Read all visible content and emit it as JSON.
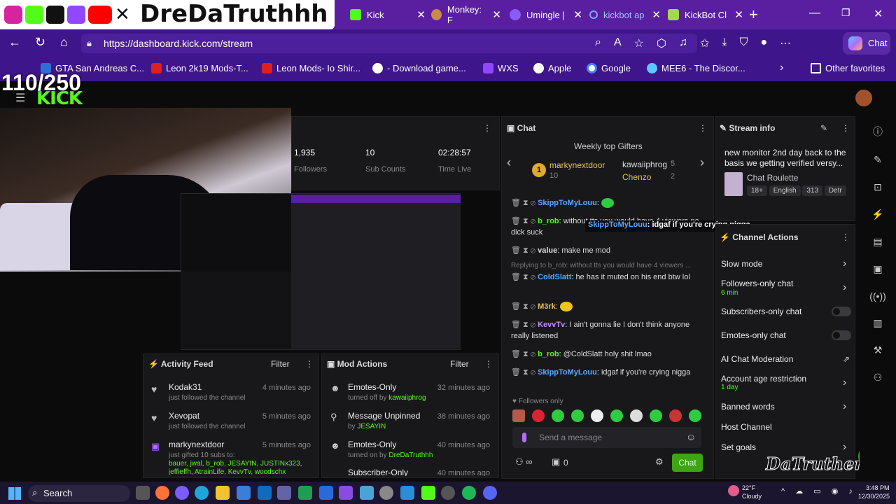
{
  "overlay": {
    "brand_name": "DreDaTruthhh",
    "counter": "110/250",
    "watermark": "DaTruthers"
  },
  "tabs": [
    {
      "label": "Kick"
    },
    {
      "label": "Monkey: F"
    },
    {
      "label": "Umingle |"
    },
    {
      "label": "kickbot ap"
    },
    {
      "label": "KickBot Cl"
    }
  ],
  "browser": {
    "url": "https://dashboard.kick.com/stream",
    "chat_label": "Chat"
  },
  "bookmarks": [
    {
      "label": "GTA San Andreas C..."
    },
    {
      "label": "Leon 2k19 Mods-T..."
    },
    {
      "label": "Leon Mods- Io Shir..."
    },
    {
      "label": "- Download game..."
    },
    {
      "label": "WXS"
    },
    {
      "label": "Apple"
    },
    {
      "label": "Google"
    },
    {
      "label": "MEE6 - The Discor..."
    },
    {
      "label": "Other favorites"
    }
  ],
  "kick": {
    "logo": "KICK",
    "stats": {
      "followers": "1,935",
      "followers_label": "Followers",
      "subs": "10",
      "subs_label": "Sub Counts",
      "time": "02:28:57",
      "time_label": "Time Live"
    }
  },
  "activity": {
    "title": "Activity Feed",
    "filter": "Filter",
    "items": [
      {
        "name": "Kodak31",
        "text": "just followed the channel",
        "time": "4 minutes ago"
      },
      {
        "name": "Xevopat",
        "text": "just followed the channel",
        "time": "5 minutes ago"
      },
      {
        "name": "markynextdoor",
        "text": "just gifted 10 subs to:",
        "time": "5 minutes ago",
        "extra": "bauer, jwal, b_rob, JESAYIN, JUSTINx323,",
        "extra2": "jeffieffh, AtrainLife, KevvTv, woodschx"
      }
    ]
  },
  "mod": {
    "title": "Mod Actions",
    "filter": "Filter",
    "items": [
      {
        "name": "Emotes-Only",
        "text": "turned off by",
        "by": "kawaiiphrog",
        "time": "32 minutes ago"
      },
      {
        "name": "Message Unpinned",
        "text": "by",
        "by": "JESAYIN",
        "time": "38 minutes ago"
      },
      {
        "name": "Emotes-Only",
        "text": "turned on by",
        "by": "DreDaTruthhh",
        "time": "40 minutes ago"
      },
      {
        "name": "Subscriber-Only",
        "text": "",
        "by": "",
        "time": "40 minutes ago"
      }
    ]
  },
  "chat": {
    "title": "Chat",
    "gifters_title": "Weekly top Gifters",
    "gifters": [
      {
        "name": "markynextdoor",
        "count": "10"
      },
      {
        "name": "kawaiiphrog",
        "count": "5"
      },
      {
        "name": "Chenzo",
        "count": "2"
      }
    ],
    "messages": [
      {
        "user": "SkippToMyLouu",
        "text": ""
      },
      {
        "user": "b_rob",
        "text": "without tts you would have 4 viewers no dick suck"
      },
      {
        "user": "value",
        "text": "make me mod"
      },
      {
        "reply": "Replying to b_rob: without tts you would have 4 viewers ...",
        "user": "ColdSlatt",
        "text": "he has it muted on his end btw lol"
      },
      {
        "user": "M3rk",
        "text": ""
      },
      {
        "user": "KevvTv",
        "text": "I ain't gonna lie I don't think anyone really listened"
      },
      {
        "user": "b_rob",
        "text": "@ColdSlatt holy shit lmao"
      },
      {
        "user": "SkippToMyLouu",
        "text": "idgaf if you're crying nigga"
      }
    ],
    "popup_user": "SkippToMyLouu",
    "popup_text": ": idgaf if you're crying nigga",
    "followers_only": "Followers only",
    "placeholder": "Send a message",
    "viewers": "0",
    "send": "Chat"
  },
  "stream_info": {
    "title": "Stream info",
    "desc": "new monitor 2nd day back to the basis we getting verified versy...",
    "category": "Chat Roulette",
    "tags": [
      "18+",
      "English",
      "313",
      "Detr"
    ]
  },
  "channel_actions": {
    "title": "Channel Actions",
    "items": [
      {
        "label": "Slow mode",
        "sub": ""
      },
      {
        "label": "Followers-only chat",
        "sub": "6 min"
      },
      {
        "label": "Subscribers-only chat",
        "sub": ""
      },
      {
        "label": "Emotes-only chat",
        "sub": ""
      },
      {
        "label": "AI Chat Moderation",
        "sub": ""
      },
      {
        "label": "Account age restriction",
        "sub": "1 day"
      },
      {
        "label": "Banned words",
        "sub": ""
      },
      {
        "label": "Host Channel",
        "sub": ""
      },
      {
        "label": "Set goals",
        "sub": ""
      }
    ]
  },
  "taskbar": {
    "search": "Search",
    "weather_temp": "22°F",
    "weather_text": "Cloudy",
    "time": "3:48 PM",
    "date": "12/30/2025"
  }
}
